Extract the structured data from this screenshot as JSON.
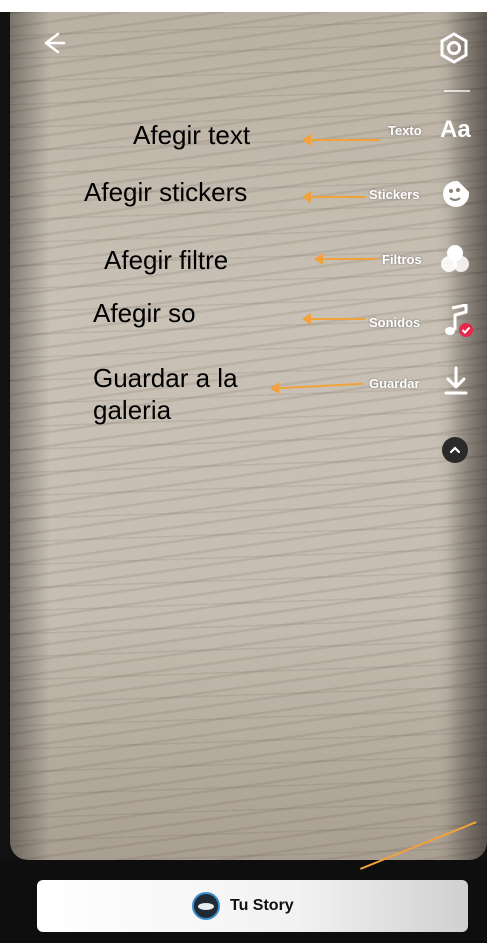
{
  "header": {
    "back_icon": "back-arrow-icon",
    "settings_icon": "gear-icon"
  },
  "menu": [
    {
      "label": "Texto",
      "icon_text": "Aa",
      "icon": "text-icon"
    },
    {
      "label": "Stickers",
      "icon": "sticker-icon"
    },
    {
      "label": "Filtros",
      "icon": "filters-icon"
    },
    {
      "label": "Sonidos",
      "icon": "music-note-icon"
    },
    {
      "label": "Guardar",
      "icon": "download-icon"
    }
  ],
  "annotations": [
    {
      "text": "Afegir text"
    },
    {
      "text": "Afegir stickers"
    },
    {
      "text": "Afegir filtre"
    },
    {
      "text": "Afegir so"
    },
    {
      "text": "Guardar a la galeria"
    }
  ],
  "footer": {
    "story_label": "Tu Story"
  },
  "colors": {
    "arrow": "#f2a23a",
    "sound_badge": "#e6294b"
  }
}
